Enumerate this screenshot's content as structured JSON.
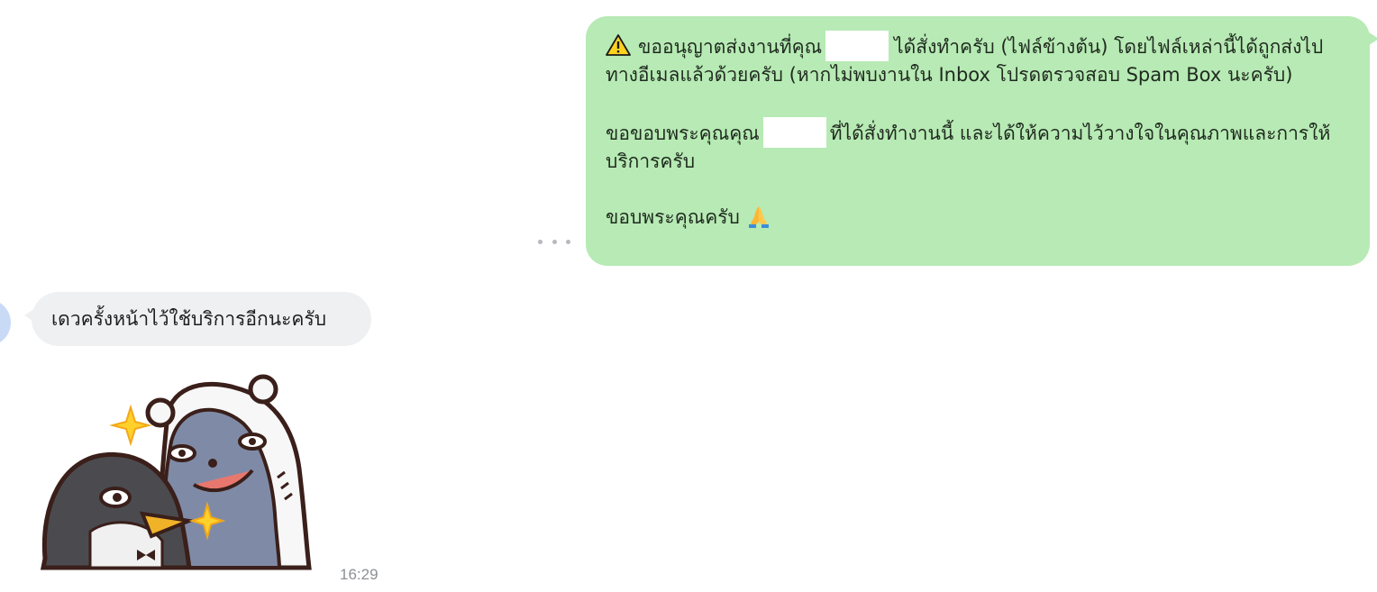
{
  "outgoing_message": {
    "line1_before": "ขออนุญาตส่งงานที่คุณ",
    "line1_after": "ได้สั่งทำครับ (ไฟล์ข้างต้น) โดยไฟล์เหล่านี้ได้ถูกส่งไปทางอีเมลแล้วด้วยครับ (หากไม่พบงานใน Inbox โปรดตรวจสอบ Spam Box นะครับ)",
    "line2_before": "ขอขอบพระคุณคุณ",
    "line2_after": "ที่ได้สั่งทำงานนี้ และได้ให้ความไว้วางใจในคุณภาพและการให้บริการครับ",
    "line3": "ขอบพระคุณครับ",
    "warning_icon": "warning-icon",
    "pray_icon": "folded-hands-icon"
  },
  "incoming_message": {
    "text": "เดวครั้งหน้าไว้ใช้บริการอีกนะครับ"
  },
  "sticker": {
    "icon": "penguin-and-bear-sticker"
  },
  "timestamp": "16:29",
  "colors": {
    "outgoing_bubble": "#b7eab4",
    "incoming_bubble": "#eff0f2",
    "timestamp": "#8d9095"
  }
}
